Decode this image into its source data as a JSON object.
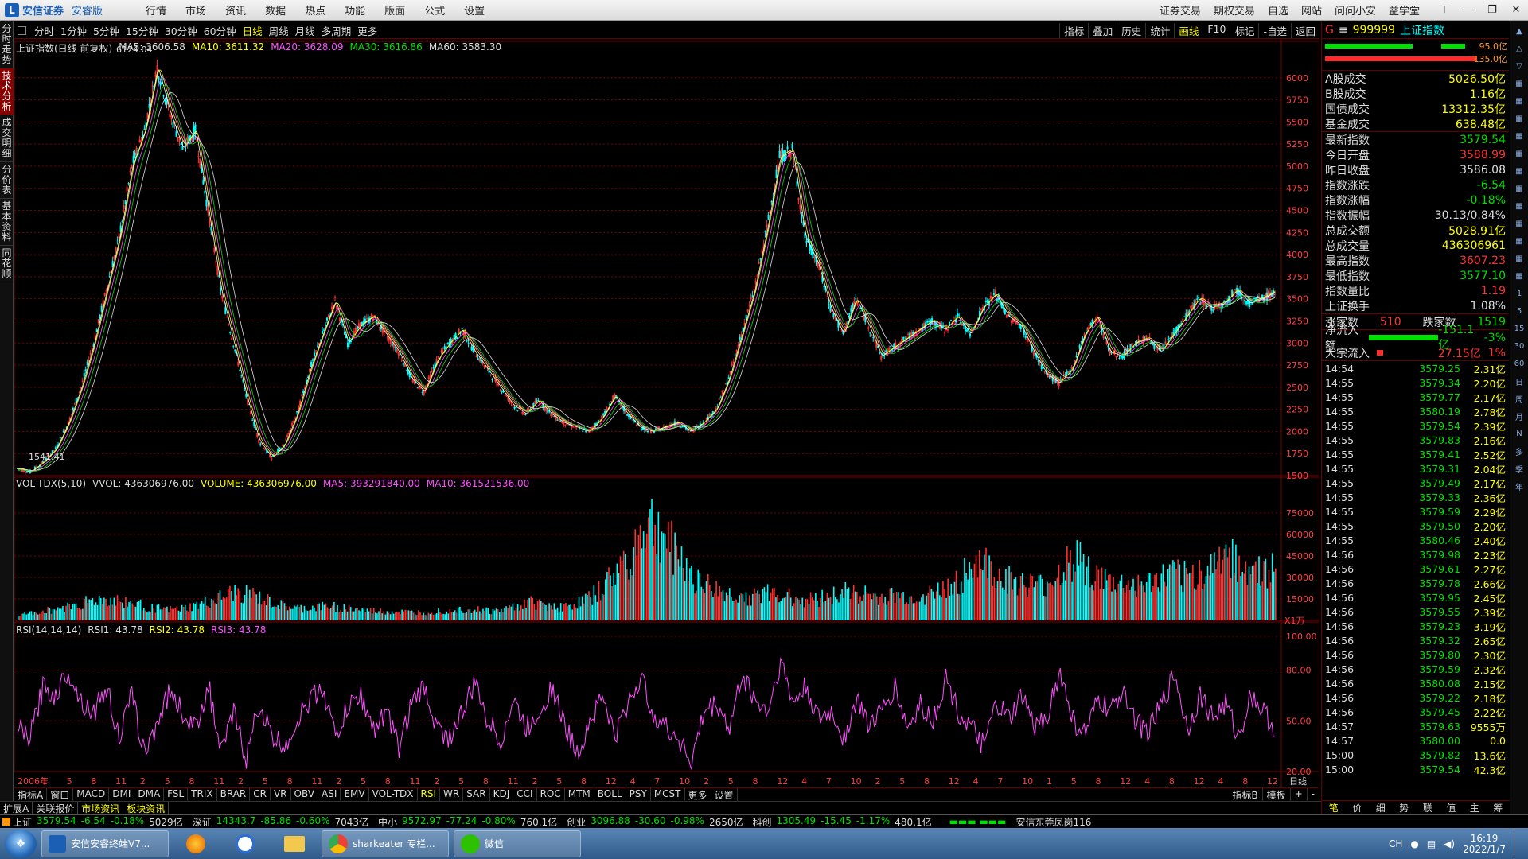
{
  "app": {
    "brand": "安信证券",
    "edition": "安睿版"
  },
  "menu": [
    "行情",
    "市场",
    "资讯",
    "数据",
    "热点",
    "功能",
    "版面",
    "公式",
    "设置"
  ],
  "right_menu": [
    "证券交易",
    "期权交易",
    "自选",
    "网站",
    "问问小安",
    "益学堂"
  ],
  "left_tabs": [
    "分时走势",
    "技术分析",
    "成交明细",
    "分价表",
    "基本资料",
    "同花顺"
  ],
  "periods": [
    "分时",
    "1分钟",
    "5分钟",
    "15分钟",
    "30分钟",
    "60分钟",
    "日线",
    "周线",
    "月线",
    "多周期",
    "更多"
  ],
  "active_period": "日线",
  "chart_buttons": [
    "指标",
    "叠加",
    "历史",
    "统计",
    "画线",
    "F10",
    "标记",
    "-自选",
    "返回"
  ],
  "indicator_tabs": [
    "指标A",
    "窗口",
    "MACD",
    "DMI",
    "DMA",
    "FSL",
    "TRIX",
    "BRAR",
    "CR",
    "VR",
    "OBV",
    "ASI",
    "EMV",
    "VOL-TDX",
    "RSI",
    "WR",
    "SAR",
    "KDJ",
    "CCI",
    "ROC",
    "MTM",
    "BOLL",
    "PSY",
    "MCST",
    "更多",
    "设置"
  ],
  "indicator_right": [
    "指标B",
    "模板",
    "+",
    "-"
  ],
  "bottom_tabs": [
    "扩展A",
    "关联报价",
    "市场资讯",
    "板块资讯"
  ],
  "main_legend": {
    "title": "上证指数(日线 前复权)",
    "ma5": "MA5: 3606.58",
    "ma10": "MA10: 3611.32",
    "ma20": "MA20: 3628.09",
    "ma30": "MA30: 3616.86",
    "ma60": "MA60: 3583.30"
  },
  "vol_legend": {
    "name": "VOL-TDX(5,10)",
    "vvol": "VVOL: 436306976.00",
    "volume": "VOLUME: 436306976.00",
    "ma5": "MA5: 393291840.00",
    "ma10": "MA10: 361521536.00"
  },
  "rsi_legend": {
    "name": "RSI(14,14,14)",
    "rsi1": "RSI1: 43.78",
    "rsi2": "RSI2: 43.78",
    "rsi3": "RSI3: 43.78"
  },
  "annotations": {
    "high": "6124.04",
    "low": "1541.41",
    "vol_unit": "X1万",
    "period_label": "日线"
  },
  "x_labels": [
    "2006年",
    "1",
    "5",
    "8",
    "11",
    "2",
    "5",
    "8",
    "11",
    "2",
    "5",
    "8",
    "11",
    "2",
    "5",
    "8",
    "11",
    "2",
    "5",
    "8",
    "11",
    "2",
    "5",
    "8",
    "12",
    "4",
    "7",
    "10",
    "2",
    "5",
    "8",
    "12",
    "4",
    "7",
    "10",
    "2",
    "5",
    "8",
    "12",
    "4",
    "7",
    "10",
    "1",
    "5",
    "8",
    "12",
    "4",
    "8",
    "12",
    "4",
    "8",
    "12"
  ],
  "chart_data": [
    {
      "type": "line",
      "title": "上证指数(日线 前复权)",
      "ylim": [
        1500,
        6250
      ],
      "yticks": [
        1500,
        1750,
        2000,
        2250,
        2500,
        2750,
        3000,
        3250,
        3500,
        3750,
        4000,
        4250,
        4500,
        4750,
        5000,
        5250,
        5500,
        5750,
        6000
      ],
      "series": [
        {
          "name": "上证指数",
          "values": [
            1580,
            1541,
            1650,
            1800,
            2100,
            2500,
            3000,
            3600,
            4200,
            5000,
            5400,
            6124,
            5600,
            5200,
            5400,
            4500,
            3600,
            3000,
            2400,
            1900,
            1700,
            1850,
            2200,
            2700,
            3100,
            3480,
            3000,
            3200,
            3300,
            3100,
            2900,
            2600,
            2450,
            2800,
            3000,
            3150,
            2900,
            2700,
            2500,
            2300,
            2200,
            2350,
            2200,
            2100,
            2050,
            2000,
            2150,
            2400,
            2200,
            2050,
            2000,
            2050,
            2100,
            2000,
            2100,
            2250,
            2600,
            3100,
            3600,
            4300,
            5100,
            5178,
            4200,
            3900,
            3400,
            3100,
            3500,
            3200,
            2850,
            2950,
            3050,
            3150,
            3250,
            3150,
            3300,
            3100,
            3400,
            3550,
            3300,
            3200,
            2900,
            2650,
            2550,
            2700,
            3100,
            3300,
            2900,
            2850,
            3000,
            3050,
            2900,
            3100,
            3300,
            3500,
            3400,
            3450,
            3600,
            3450,
            3500,
            3580
          ]
        }
      ]
    },
    {
      "type": "bar",
      "title": "VOL-TDX(5,10)",
      "ylim": [
        0,
        90000
      ],
      "yticks": [
        15000,
        30000,
        45000,
        60000,
        75000
      ],
      "series": [
        {
          "name": "VOLUME",
          "values": [
            4000,
            6000,
            8000,
            11000,
            14000,
            16000,
            15000,
            13000,
            10000,
            8000,
            9000,
            12000,
            16000,
            21000,
            20000,
            15000,
            11000,
            9000,
            10000,
            11000,
            9000,
            7500,
            7000,
            6500,
            6000,
            7000,
            8000,
            9000,
            8000,
            7000,
            11000,
            14000,
            12000,
            10000,
            14000,
            21000,
            35000,
            50000,
            76000,
            65000,
            48000,
            32000,
            24000,
            20000,
            18000,
            20000,
            21000,
            17000,
            16000,
            19000,
            22000,
            21000,
            17000,
            19000,
            17000,
            20000,
            24000,
            32000,
            47000,
            36000,
            30000,
            27000,
            26000,
            36000,
            52000,
            34000,
            28000,
            27000,
            26000,
            31000,
            35000,
            34000,
            38000,
            55000,
            43000,
            37000,
            38000
          ]
        }
      ]
    },
    {
      "type": "line",
      "title": "RSI(14,14,14)",
      "ylim": [
        20,
        100
      ],
      "yticks": [
        20,
        50,
        80,
        100
      ],
      "series": [
        {
          "name": "RSI1",
          "values": [
            45,
            40,
            70,
            65,
            80,
            62,
            55,
            70,
            40,
            65,
            30,
            50,
            68,
            55,
            45,
            72,
            30,
            55,
            28,
            60,
            40,
            35,
            50,
            62,
            70,
            40,
            58,
            65,
            45,
            55,
            35,
            60,
            70,
            45,
            40,
            55,
            72,
            50,
            38,
            62,
            45,
            55,
            70,
            48,
            30,
            50,
            65,
            40,
            60,
            75,
            55,
            45,
            40,
            25,
            55,
            60,
            45,
            78,
            62,
            55,
            85,
            60,
            70,
            50,
            55,
            40,
            62,
            48,
            55,
            70,
            45,
            60,
            50,
            75,
            55,
            45,
            35,
            60,
            50,
            65,
            45,
            55,
            78,
            50,
            42,
            62,
            55,
            70,
            48,
            44,
            60,
            78,
            45,
            65,
            52,
            60,
            40,
            66,
            55,
            44
          ]
        }
      ]
    }
  ],
  "right_panel": {
    "code": "999999",
    "name": "上证指数",
    "g": "G",
    "bar_labels": [
      "95.0亿",
      "135.0亿"
    ],
    "turnover": [
      {
        "k": "A股成交",
        "v": "5026.50亿"
      },
      {
        "k": "B股成交",
        "v": "1.16亿"
      },
      {
        "k": "国债成交",
        "v": "13312.35亿"
      },
      {
        "k": "基金成交",
        "v": "638.48亿"
      }
    ],
    "quote": [
      {
        "k": "最新指数",
        "v": "3579.54",
        "c": "g"
      },
      {
        "k": "今日开盘",
        "v": "3588.99",
        "c": "r"
      },
      {
        "k": "昨日收盘",
        "v": "3586.08",
        "c": "w"
      },
      {
        "k": "指数涨跌",
        "v": "-6.54",
        "c": "g"
      },
      {
        "k": "指数涨幅",
        "v": "-0.18%",
        "c": "g"
      },
      {
        "k": "指数振幅",
        "v": "30.13/0.84%",
        "c": "w"
      },
      {
        "k": "总成交额",
        "v": "5028.91亿",
        "c": "y"
      },
      {
        "k": "总成交量",
        "v": "436306961",
        "c": "y"
      },
      {
        "k": "最高指数",
        "v": "3607.23",
        "c": "r"
      },
      {
        "k": "最低指数",
        "v": "3577.10",
        "c": "g"
      },
      {
        "k": "指数量比",
        "v": "1.19",
        "c": "r"
      },
      {
        "k": "上证换手",
        "v": "1.08%",
        "c": "w"
      }
    ],
    "breadth": {
      "up_label": "涨家数",
      "up": "510",
      "down_label": "跌家数",
      "down": "1519"
    },
    "flow": [
      {
        "k": "净流入额",
        "v": "-151.1亿",
        "p": "-3%"
      },
      {
        "k": "大宗流入",
        "v": "27.15亿",
        "p": "1%"
      }
    ],
    "ticks": [
      {
        "t": "14:54",
        "p": "3579.25",
        "c": "g",
        "v": "2.31亿"
      },
      {
        "t": "14:55",
        "p": "3579.34",
        "c": "g",
        "v": "2.20亿"
      },
      {
        "t": "14:55",
        "p": "3579.77",
        "c": "g",
        "v": "2.17亿"
      },
      {
        "t": "14:55",
        "p": "3580.19",
        "c": "g",
        "v": "2.78亿"
      },
      {
        "t": "14:55",
        "p": "3579.54",
        "c": "g",
        "v": "2.39亿"
      },
      {
        "t": "14:55",
        "p": "3579.83",
        "c": "g",
        "v": "2.16亿"
      },
      {
        "t": "14:55",
        "p": "3579.41",
        "c": "g",
        "v": "2.52亿"
      },
      {
        "t": "14:55",
        "p": "3579.31",
        "c": "g",
        "v": "2.04亿"
      },
      {
        "t": "14:55",
        "p": "3579.49",
        "c": "g",
        "v": "2.17亿"
      },
      {
        "t": "14:55",
        "p": "3579.33",
        "c": "g",
        "v": "2.36亿"
      },
      {
        "t": "14:55",
        "p": "3579.59",
        "c": "g",
        "v": "2.29亿"
      },
      {
        "t": "14:55",
        "p": "3579.50",
        "c": "g",
        "v": "2.20亿"
      },
      {
        "t": "14:55",
        "p": "3580.46",
        "c": "g",
        "v": "2.40亿"
      },
      {
        "t": "14:56",
        "p": "3579.98",
        "c": "g",
        "v": "2.23亿"
      },
      {
        "t": "14:56",
        "p": "3579.61",
        "c": "g",
        "v": "2.27亿"
      },
      {
        "t": "14:56",
        "p": "3579.78",
        "c": "g",
        "v": "2.66亿"
      },
      {
        "t": "14:56",
        "p": "3579.95",
        "c": "g",
        "v": "2.45亿"
      },
      {
        "t": "14:56",
        "p": "3579.55",
        "c": "g",
        "v": "2.39亿"
      },
      {
        "t": "14:56",
        "p": "3579.23",
        "c": "g",
        "v": "3.19亿"
      },
      {
        "t": "14:56",
        "p": "3579.32",
        "c": "g",
        "v": "2.65亿"
      },
      {
        "t": "14:56",
        "p": "3579.80",
        "c": "g",
        "v": "2.30亿"
      },
      {
        "t": "14:56",
        "p": "3579.59",
        "c": "g",
        "v": "2.32亿"
      },
      {
        "t": "14:56",
        "p": "3580.08",
        "c": "g",
        "v": "2.15亿"
      },
      {
        "t": "14:56",
        "p": "3579.22",
        "c": "g",
        "v": "2.18亿"
      },
      {
        "t": "14:56",
        "p": "3579.45",
        "c": "g",
        "v": "2.22亿"
      },
      {
        "t": "14:57",
        "p": "3579.63",
        "c": "g",
        "v": "9555万"
      },
      {
        "t": "14:57",
        "p": "3580.00",
        "c": "g",
        "v": "0.0"
      },
      {
        "t": "15:00",
        "p": "3579.82",
        "c": "g",
        "v": "13.6亿"
      },
      {
        "t": "15:00",
        "p": "3579.54",
        "c": "g",
        "v": "42.3亿"
      }
    ],
    "bottom_tabs": [
      "笔",
      "价",
      "细",
      "势",
      "联",
      "值",
      "主",
      "筹"
    ]
  },
  "toolstrip": [
    "1",
    "5",
    "15",
    "30",
    "60",
    "日",
    "周",
    "月",
    "N",
    "多",
    "季",
    "年"
  ],
  "ticker": [
    {
      "name": "上证",
      "price": "3579.54",
      "chg": "-6.54",
      "pct": "-0.18%",
      "amt": "5029亿",
      "c": "g"
    },
    {
      "name": "深证",
      "price": "14343.7",
      "chg": "-85.86",
      "pct": "-0.60%",
      "amt": "7043亿",
      "c": "g"
    },
    {
      "name": "中小",
      "price": "9572.97",
      "chg": "-77.24",
      "pct": "-0.80%",
      "amt": "760.1亿",
      "c": "g"
    },
    {
      "name": "创业",
      "price": "3096.88",
      "chg": "-30.60",
      "pct": "-0.98%",
      "amt": "2650亿",
      "c": "g"
    },
    {
      "name": "科创",
      "price": "1305.49",
      "chg": "-15.45",
      "pct": "-1.17%",
      "amt": "480.1亿",
      "c": "g"
    }
  ],
  "ticker_branch": "安信东莞凤岗116",
  "taskbar": {
    "items": [
      {
        "label": "安信安睿终端V7..."
      },
      {
        "label": "sharkeater 专栏..."
      },
      {
        "label": "微信"
      }
    ],
    "tray_lang": "CH",
    "time": "16:19",
    "date": "2022/1/7"
  },
  "colors": {
    "up": "#ff3232",
    "down": "#00e000",
    "cyan": "#00ffff",
    "yellow": "#ffff00",
    "magenta": "#ff50ff",
    "grid": "#7a0000"
  }
}
